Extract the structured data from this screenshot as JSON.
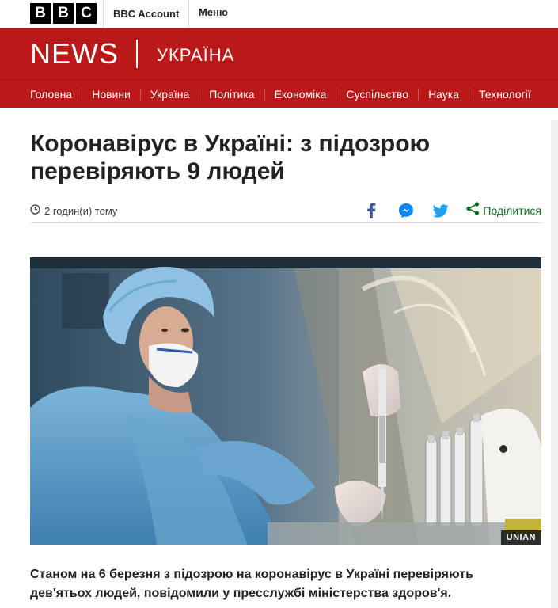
{
  "topbar": {
    "logo_letters": [
      "B",
      "B",
      "C"
    ],
    "account_label": "BBC Account",
    "menu_label": "Меню"
  },
  "header": {
    "brand": "NEWS",
    "region": "УКРАЇНА",
    "brand_color": "#bb1919"
  },
  "nav": {
    "items": [
      "Головна",
      "Новини",
      "Україна",
      "Політика",
      "Економіка",
      "Суспільство",
      "Наука",
      "Технології"
    ]
  },
  "article": {
    "headline": "Коронавірус в Україні: з підозрою перевіряють 9 людей",
    "timestamp": "2 годин(и) тому",
    "share_label": "Поділитися",
    "share_icons": [
      "facebook-icon",
      "messenger-icon",
      "twitter-icon",
      "share-icon"
    ],
    "image_credit": "UNIAN",
    "lead": "Станом на 6 березня з підозрою на коронавірус в Україні перевіряють дев'ятьох людей, повідомили у пресслужбі міністерства здоров'я."
  }
}
